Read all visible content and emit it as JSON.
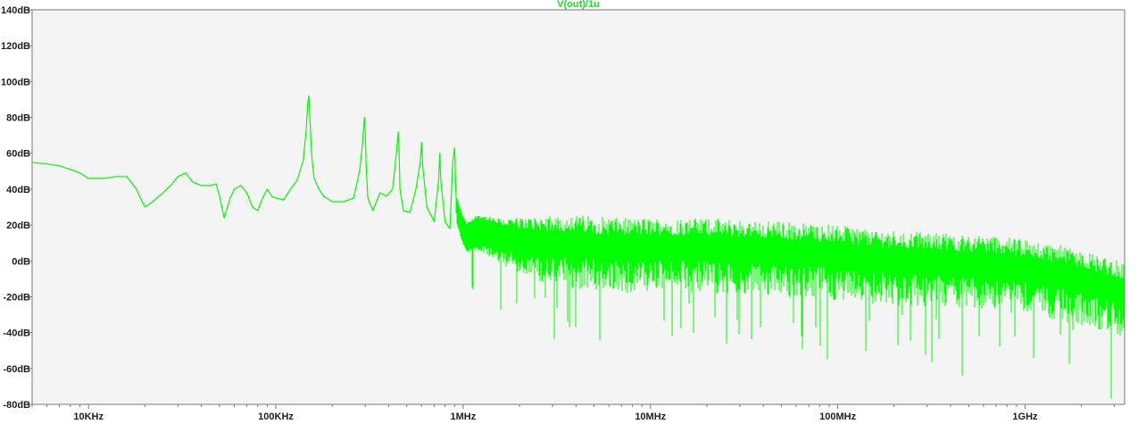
{
  "window": {
    "trace_label": "V(out)/1u"
  },
  "colors": {
    "trace": "#00ff00",
    "plot_bg": "#f4f4f4",
    "axis": "#7a7a7a",
    "label": "#202020"
  },
  "chart_data": {
    "type": "line",
    "title": "V(out)/1u",
    "xscale": "log",
    "xlim": [
      5000,
      3400000000
    ],
    "ylim": [
      -80,
      140
    ],
    "x_ticks": [
      {
        "value": 10000,
        "label": "10KHz"
      },
      {
        "value": 100000,
        "label": "100KHz"
      },
      {
        "value": 1000000,
        "label": "1MHz"
      },
      {
        "value": 10000000,
        "label": "10MHz"
      },
      {
        "value": 100000000,
        "label": "100MHz"
      },
      {
        "value": 1000000000,
        "label": "1GHz"
      }
    ],
    "y_ticks": [
      {
        "value": 140,
        "label": "140dB"
      },
      {
        "value": 120,
        "label": "120dB"
      },
      {
        "value": 100,
        "label": "100dB"
      },
      {
        "value": 80,
        "label": "80dB"
      },
      {
        "value": 60,
        "label": "60dB"
      },
      {
        "value": 40,
        "label": "40dB"
      },
      {
        "value": 20,
        "label": "20dB"
      },
      {
        "value": 0,
        "label": "0dB"
      },
      {
        "value": -20,
        "label": "-20dB"
      },
      {
        "value": -40,
        "label": "-40dB"
      },
      {
        "value": -60,
        "label": "-60dB"
      },
      {
        "value": -80,
        "label": "-80dB"
      }
    ],
    "grid": false,
    "series": [
      {
        "name": "V(out)/1u",
        "x": [
          5000,
          6000,
          7000,
          8000,
          9000,
          10000,
          12000,
          14000,
          16000,
          18000,
          20000,
          22000,
          25000,
          28000,
          30000,
          33000,
          36000,
          40000,
          45000,
          48000,
          50000,
          53000,
          57000,
          60000,
          65000,
          70000,
          75000,
          80000,
          85000,
          90000,
          95000,
          100000,
          110000,
          120000,
          130000,
          140000,
          145000,
          148000,
          150000,
          152000,
          155000,
          160000,
          170000,
          180000,
          200000,
          230000,
          260000,
          280000,
          290000,
          297000,
          300000,
          303000,
          310000,
          330000,
          360000,
          390000,
          420000,
          440000,
          450000,
          455000,
          460000,
          480000,
          520000,
          560000,
          590000,
          600000,
          610000,
          640000,
          700000,
          740000,
          750000,
          760000,
          800000,
          850000,
          880000,
          900000,
          920000,
          1000000,
          1050000,
          1200000,
          1500000,
          2000000,
          3000000,
          4000000,
          5000000,
          7000000,
          10000000,
          15000000,
          20000000,
          30000000,
          50000000,
          70000000,
          100000000,
          150000000,
          200000000,
          300000000,
          500000000,
          700000000,
          1000000000,
          1500000000,
          2000000000,
          2500000000,
          3000000000,
          3400000000
        ],
        "y": [
          55,
          54,
          53,
          51,
          49,
          46,
          46,
          47,
          47,
          40,
          30,
          33,
          38,
          43,
          47,
          49,
          44,
          42,
          42,
          43,
          36,
          24,
          35,
          40,
          42,
          38,
          30,
          28,
          35,
          40,
          36,
          35,
          34,
          40,
          45,
          56,
          72,
          88,
          92,
          80,
          60,
          46,
          40,
          36,
          33,
          33,
          35,
          50,
          65,
          80,
          72,
          55,
          35,
          28,
          38,
          36,
          40,
          60,
          72,
          62,
          40,
          28,
          27,
          40,
          55,
          66,
          52,
          30,
          22,
          45,
          60,
          45,
          22,
          18,
          55,
          63,
          30,
          18,
          14,
          18,
          14,
          12,
          10,
          10,
          9,
          8,
          8,
          8,
          8,
          7,
          6,
          5,
          4,
          2,
          1,
          0,
          -1,
          -2,
          -4,
          -7,
          -10,
          -13,
          -15,
          -17
        ]
      }
    ]
  }
}
